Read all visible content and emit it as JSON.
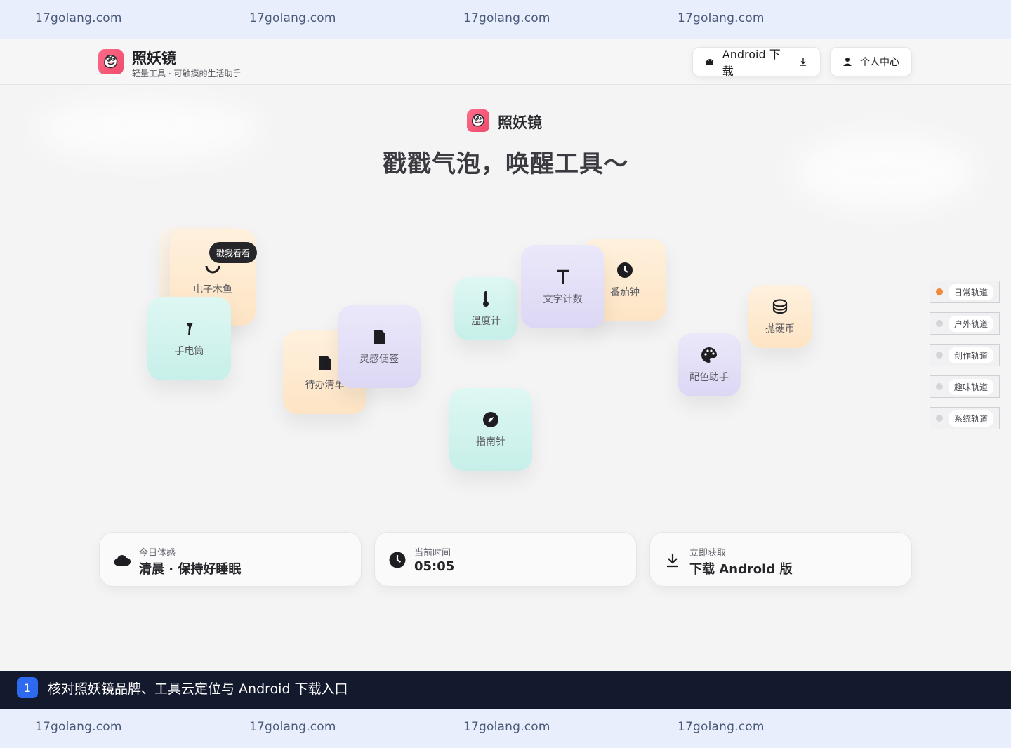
{
  "watermark": {
    "text": "17golang.com"
  },
  "header": {
    "brand_title": "照妖镜",
    "brand_subtitle": "轻量工具 · 可触摸的生活助手",
    "android_button": "Android 下载",
    "profile_button": "个人中心"
  },
  "hero": {
    "brand": "照妖镜",
    "title": "戳戳气泡，唤醒工具～"
  },
  "tools": {
    "muyu": "电子木鱼",
    "muyu_tooltip": "戳我看看",
    "flashlight": "手电筒",
    "todo": "待办清单",
    "notes": "灵感便签",
    "thermometer": "温度计",
    "wordcount": "文字计数",
    "pomodoro": "番茄钟",
    "compass": "指南针",
    "palette": "配色助手",
    "coin": "抛硬币"
  },
  "rail": {
    "items": [
      {
        "label": "日常轨道",
        "active": true
      },
      {
        "label": "户外轨道",
        "active": false
      },
      {
        "label": "创作轨道",
        "active": false
      },
      {
        "label": "趣味轨道",
        "active": false
      },
      {
        "label": "系统轨道",
        "active": false
      }
    ]
  },
  "cards": {
    "mood_label": "今日体感",
    "mood_value": "清晨 · 保持好睡眠",
    "time_label": "当前时间",
    "time_value": "05:05",
    "download_label": "立即获取",
    "download_value": "下载 Android 版"
  },
  "caption": {
    "number": "1",
    "text": "核对照妖镜品牌、工具云定位与 Android 下载入口"
  },
  "colors": {
    "accent_orange": "#f08a3a",
    "logo_pink": "#ef4a6a",
    "caption_bg": "#141a2e",
    "caption_badge": "#2e6af0"
  }
}
